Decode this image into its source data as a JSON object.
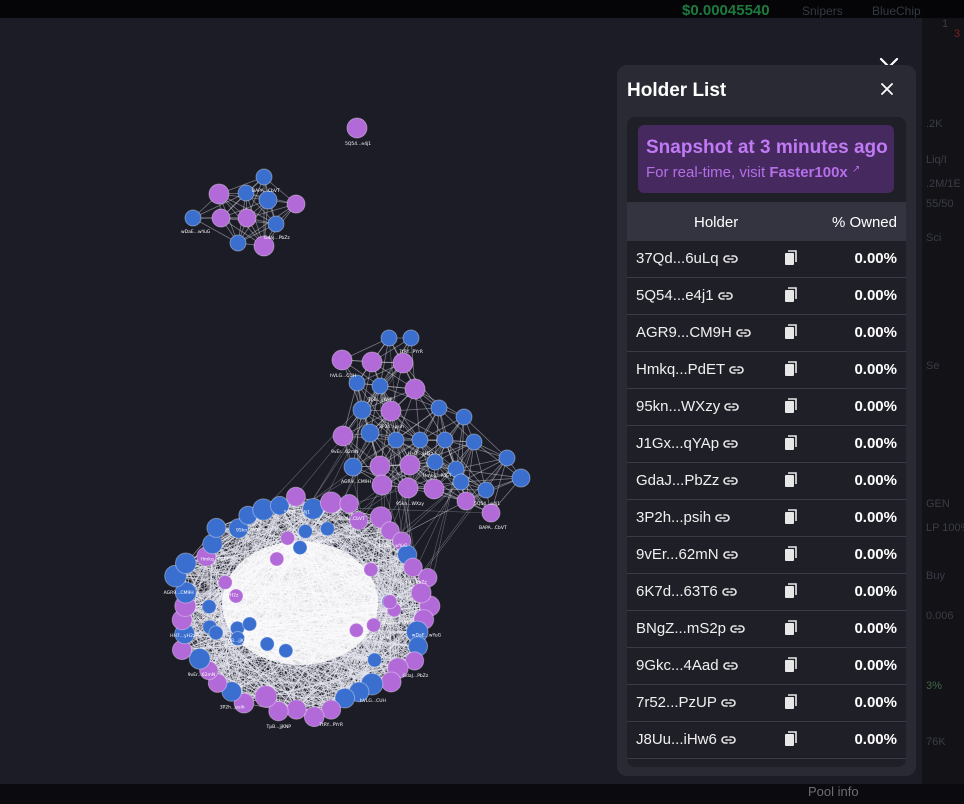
{
  "background": {
    "price": "$0.00045540",
    "links": [
      "Snipers",
      "BlueChip"
    ],
    "right_fragments": [
      "1",
      "3",
      ".2K",
      "Liq/I",
      ".2M/1E",
      "55/50",
      "Sci",
      "Se",
      "GEN",
      "LP 100%",
      "Buy",
      "0.006",
      "3%",
      "76K"
    ],
    "pool_info": "Pool info"
  },
  "holder_panel": {
    "title": "Holder List",
    "snapshot_title": "Snapshot at 3 minutes ago",
    "realtime_prefix": "For real-time, visit",
    "realtime_link": "Faster100x",
    "col_holder": "Holder",
    "col_owned": "% Owned",
    "rows": [
      {
        "address": "37Qd...6uLq",
        "owned": "0.00%"
      },
      {
        "address": "5Q54...e4j1",
        "owned": "0.00%"
      },
      {
        "address": "AGR9...CM9H",
        "owned": "0.00%"
      },
      {
        "address": "Hmkq...PdET",
        "owned": "0.00%"
      },
      {
        "address": "95kn...WXzy",
        "owned": "0.00%"
      },
      {
        "address": "J1Gx...qYAp",
        "owned": "0.00%"
      },
      {
        "address": "GdaJ...PbZz",
        "owned": "0.00%"
      },
      {
        "address": "3P2h...psih",
        "owned": "0.00%"
      },
      {
        "address": "9vEr...62mN",
        "owned": "0.00%"
      },
      {
        "address": "6K7d...63T6",
        "owned": "0.00%"
      },
      {
        "address": "BNgZ...mS2p",
        "owned": "0.00%"
      },
      {
        "address": "9Gkc...4Aad",
        "owned": "0.00%"
      },
      {
        "address": "7r52...PzUP",
        "owned": "0.00%"
      },
      {
        "address": "J8Uu...iHw6",
        "owned": "0.00%"
      }
    ]
  },
  "graph": {
    "purple": "#b36ad9",
    "blue": "#3a6fd0",
    "edge": "#e6e6f0",
    "labels": [
      "5Q54...e4j1",
      "BAPA...CbVT",
      "wDaE...wYuG",
      "GdaJ...PbZz",
      "hVLG...CUH",
      "7tRY...PYrR",
      "TpB...jjKNP",
      "3P2h...psih",
      "9vEr...62mN",
      "HH7...yH2z",
      "AGR9...CM9H",
      "Hmkq...PdET",
      "95kn...WXzy"
    ]
  }
}
